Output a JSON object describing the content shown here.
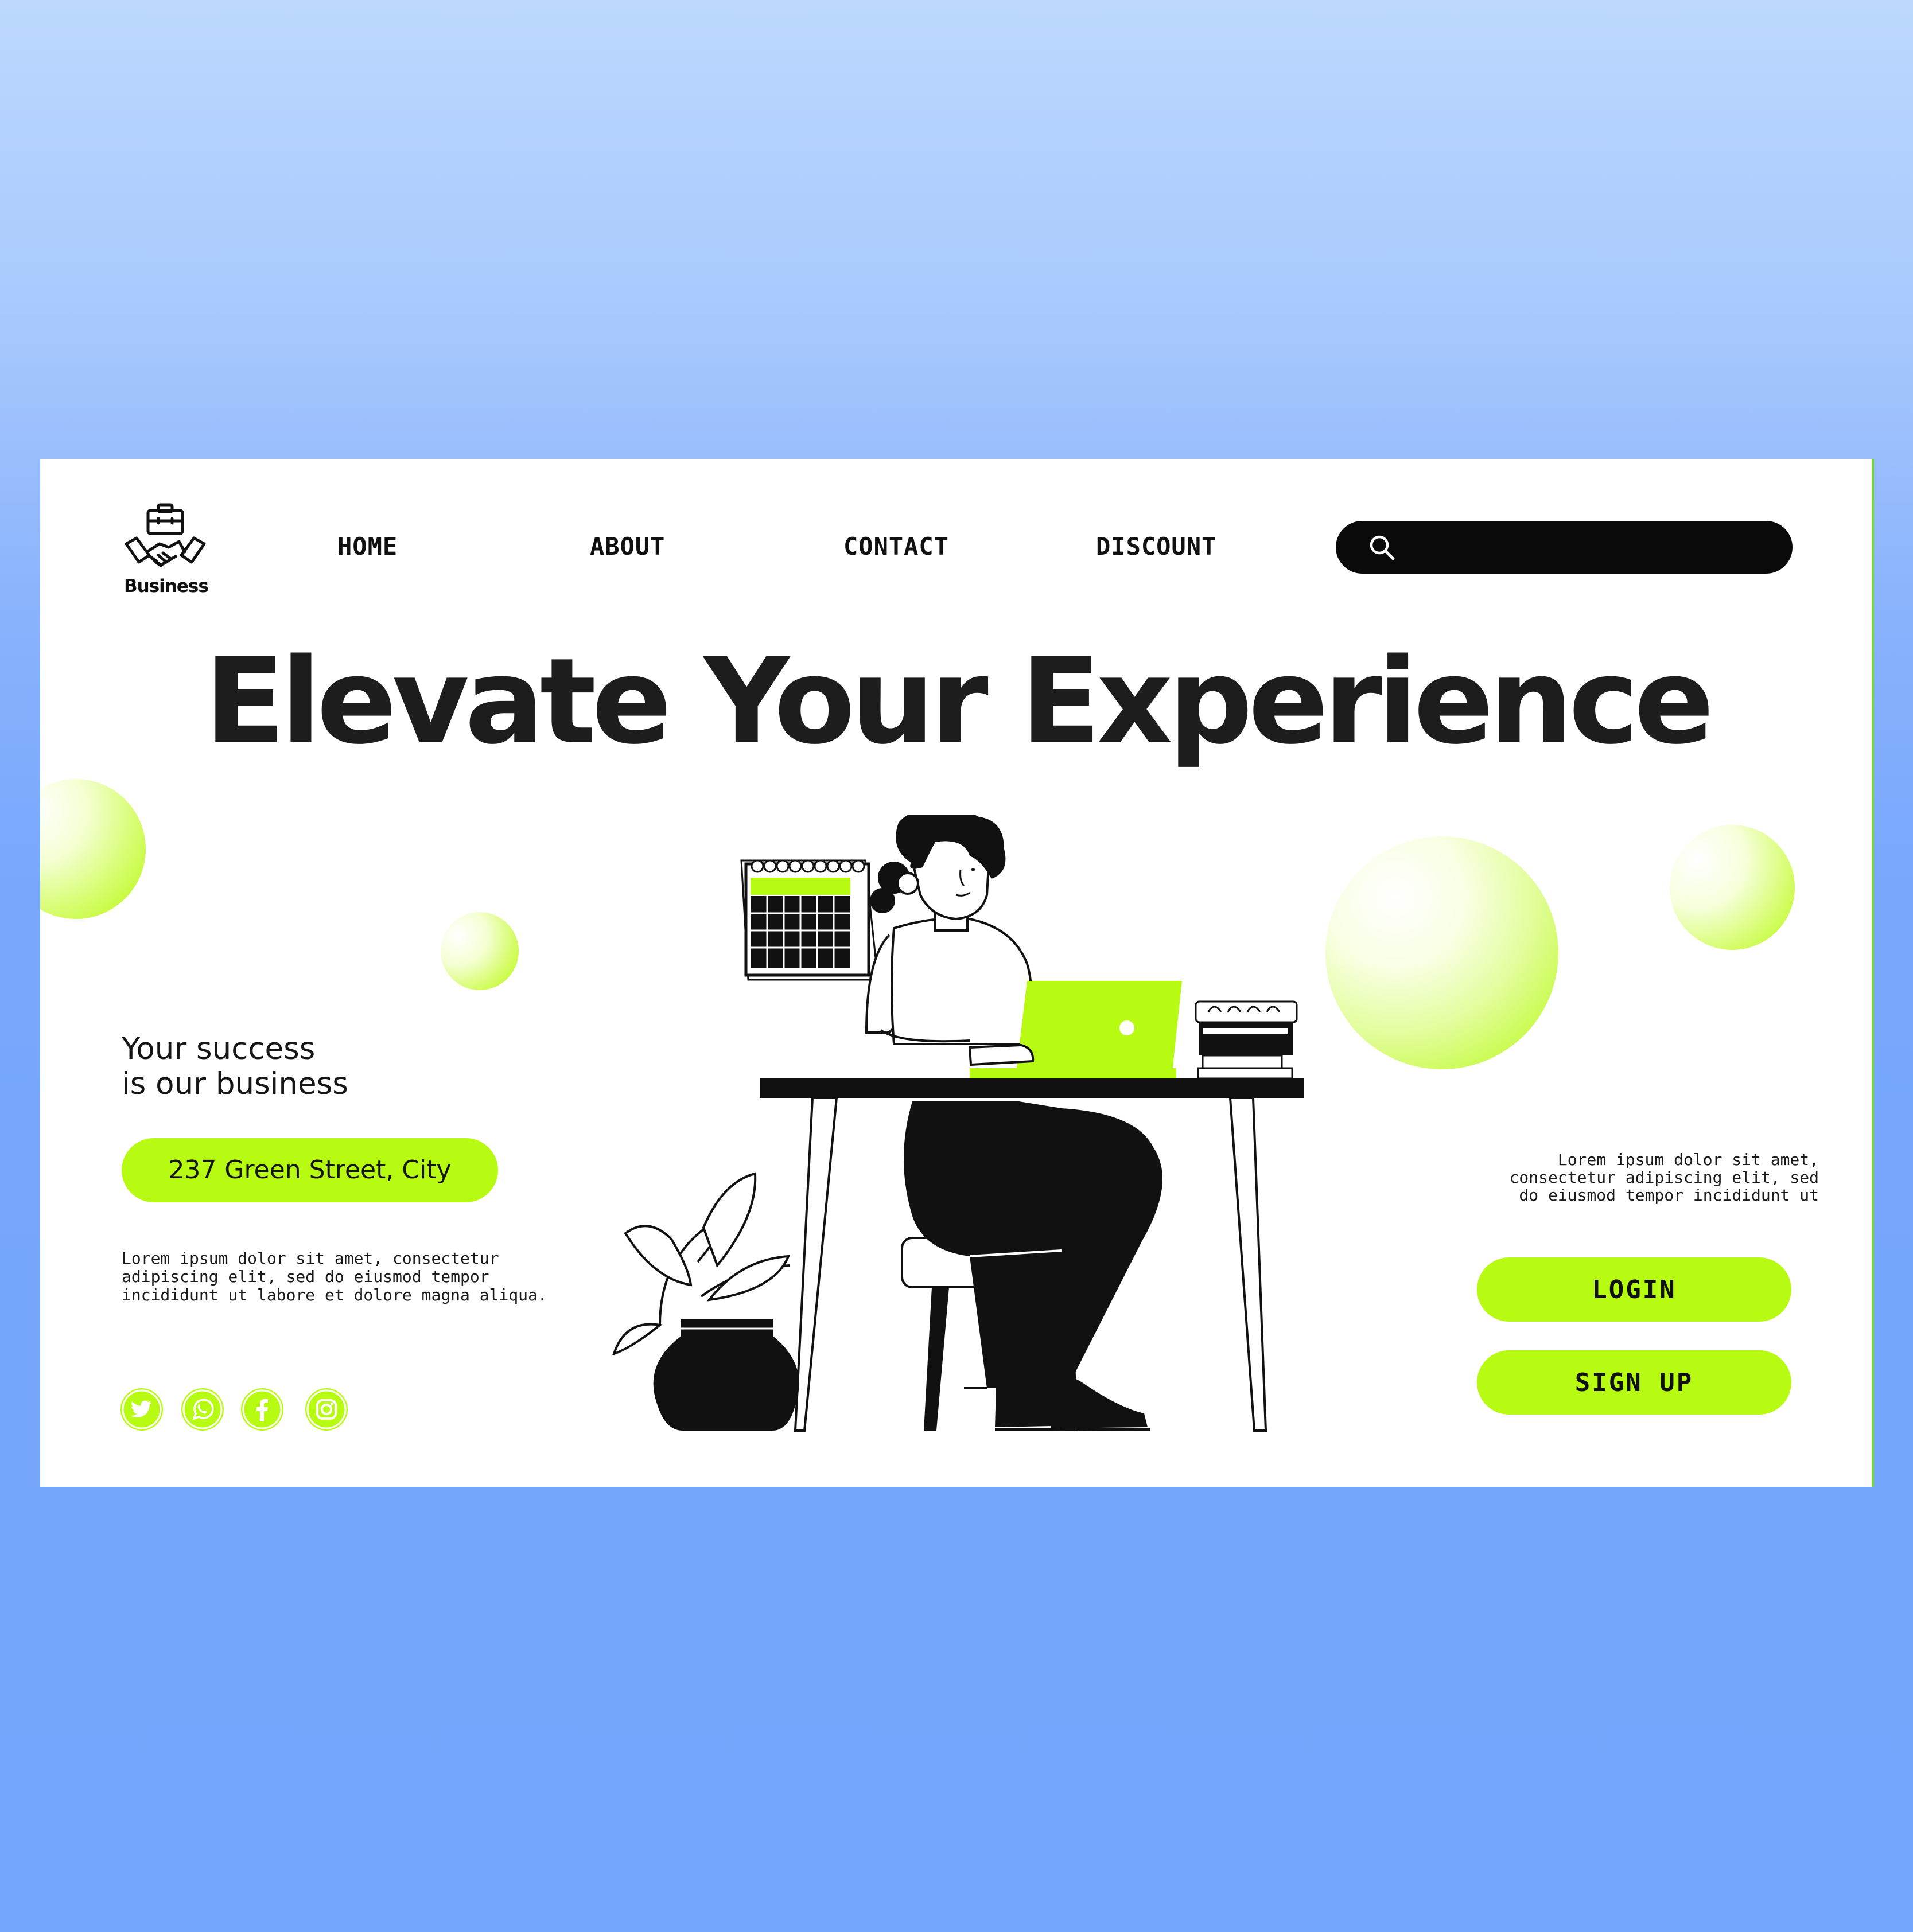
{
  "logo": {
    "label": "Business",
    "icon": "handshake-briefcase-icon"
  },
  "nav": {
    "items": [
      {
        "label": "HOME"
      },
      {
        "label": "ABOUT"
      },
      {
        "label": "CONTACT"
      },
      {
        "label": "DISCOUNT"
      }
    ]
  },
  "search": {
    "icon": "search-icon",
    "value": "",
    "placeholder": ""
  },
  "hero": {
    "title": "Elevate Your Experience",
    "illustration": "woman-working-at-laptop-desk-illustration"
  },
  "left": {
    "tagline_line1": "Your success",
    "tagline_line2": "is our business",
    "address": "237 Green Street, City",
    "body": [
      "Lorem ipsum dolor sit amet, consectetur",
      "adipiscing elit, sed do eiusmod tempor",
      "incididunt ut labore et dolore magna aliqua."
    ],
    "social_icons": [
      "twitter-icon",
      "whatsapp-icon",
      "facebook-icon",
      "instagram-icon"
    ]
  },
  "right": {
    "body": [
      "Lorem ipsum dolor sit amet,",
      "consectetur adipiscing elit, sed",
      "do eiusmod tempor incididunt ut"
    ],
    "login_label": "LOGIN",
    "signup_label": "SIGN UP"
  },
  "colors": {
    "accent": "#b7fb12",
    "text": "#1d1d1d",
    "search_bg": "#0a0a0a",
    "background_top": "#bcd8fe",
    "background_bottom": "#74a5fc"
  }
}
